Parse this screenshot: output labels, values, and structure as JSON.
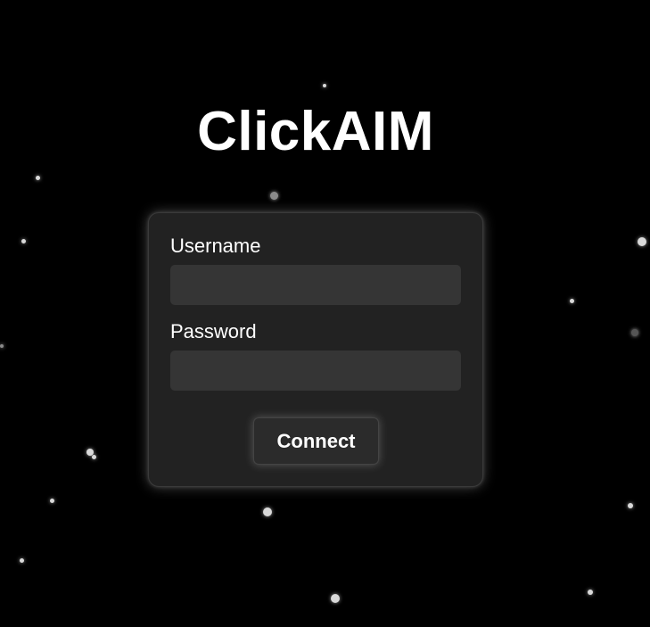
{
  "app": {
    "title": "ClickAIM"
  },
  "login_form": {
    "username_label": "Username",
    "username_value": "",
    "password_label": "Password",
    "password_value": "",
    "connect_label": "Connect"
  },
  "colors": {
    "background": "#000000",
    "card": "#222222",
    "input": "#353535",
    "text": "#ffffff"
  }
}
